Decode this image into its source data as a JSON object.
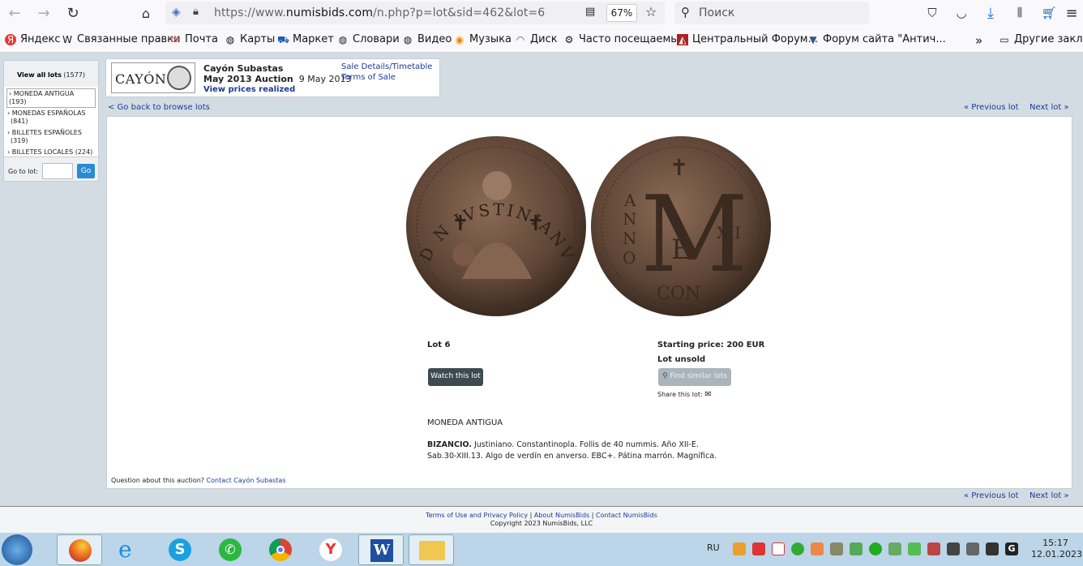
{
  "browser": {
    "url_prefix": "https://www.",
    "url_domain": "numisbids.com",
    "url_path": "/n.php?p=lot&sid=462&lot=6",
    "zoom": "67%",
    "search_placeholder": "Поиск"
  },
  "bookmarks": [
    "Яндекс",
    "Связанные правки",
    "Почта",
    "Карты",
    "Маркет",
    "Словари",
    "Видео",
    "Музыка",
    "Диск",
    "Часто посещаемые",
    "Центральный Форум...",
    "Форум сайта \"Антич...",
    "Другие закладк"
  ],
  "sidebar": {
    "view_all": "View all lots",
    "view_all_count": "(1577)",
    "items": [
      "MONEDA ANTIGUA (193)",
      "MONEDAS ESPAÑOLAS (841)",
      "BILLETES ESPAÑOLES (319)",
      "BILLETES LOCALES (224)"
    ],
    "goto_label": "Go to lot:",
    "go": "Go"
  },
  "header": {
    "logo": "CAYÓN",
    "house": "Cayón Subastas",
    "auction": "May 2013 Auction",
    "date": "9 May 2013",
    "prices": "View prices realized",
    "sale_details": "Sale Details/Timetable",
    "terms": "Terms of Sale"
  },
  "nav": {
    "back": "< Go back to browse lots",
    "prev": "« Previous lot",
    "next": "Next lot »"
  },
  "coin_obverse_legend": "D N IVSTINIANVS PP AVG",
  "coin_reverse": [
    "A",
    "N",
    "N",
    "O",
    "M",
    "E",
    "XII",
    "CON"
  ],
  "lot": {
    "number": "Lot 6",
    "start": "Starting price: 200 EUR",
    "status": "Lot unsold",
    "watch": "Watch this lot",
    "similar": "Find similar lots",
    "share": "Share this lot:",
    "category": "MONEDA ANTIGUA",
    "desc_bold": "BIZANCIO.",
    "desc_1": " Justiniano. Constantinopla. Follis de 40 nummis. Año XII-E.",
    "desc_2": "Sab.30-XIII.13. Algo de verdín en anverso. EBC+. Pátina marrón. Magnífica."
  },
  "question": "Question about this auction? ",
  "contact": "Contact Cayón Subastas",
  "footer": {
    "terms": "Terms of Use and Privacy Policy",
    "about": "About NumisBids",
    "contact": "Contact NumisBids",
    "copy": "Copyright 2023 NumisBids, LLC"
  },
  "taskbar": {
    "lang": "RU",
    "time": "15:17",
    "date": "12.01.2023"
  },
  "colors": {
    "link": "#1d3a96",
    "page_bg": "#d3dce3",
    "taskbar": "#bcd5e8"
  }
}
